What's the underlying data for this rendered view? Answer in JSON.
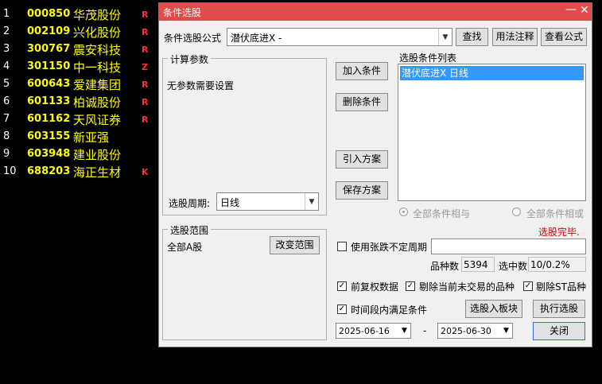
{
  "stocks": [
    {
      "idx": "1",
      "code": "000850",
      "name": "华茂股份",
      "flag": "R"
    },
    {
      "idx": "2",
      "code": "002109",
      "name": "兴化股份",
      "flag": "R"
    },
    {
      "idx": "3",
      "code": "300767",
      "name": "震安科技",
      "flag": "R"
    },
    {
      "idx": "4",
      "code": "301150",
      "name": "中一科技",
      "flag": "Z"
    },
    {
      "idx": "5",
      "code": "600643",
      "name": "爱建集团",
      "flag": "R"
    },
    {
      "idx": "6",
      "code": "601133",
      "name": "柏诚股份",
      "flag": "R"
    },
    {
      "idx": "7",
      "code": "601162",
      "name": "天风证券",
      "flag": "R"
    },
    {
      "idx": "8",
      "code": "603155",
      "name": "新亚强",
      "flag": ""
    },
    {
      "idx": "9",
      "code": "603948",
      "name": "建业股份",
      "flag": ""
    },
    {
      "idx": "10",
      "code": "688203",
      "name": "海正生材",
      "flag": "K"
    }
  ],
  "dialog": {
    "title": "条件选股",
    "formula_label": "条件选股公式",
    "formula_value": "潜伏底进X    -",
    "find_button": "查找",
    "usage_button": "用法注释",
    "view_formula_button": "查看公式",
    "calc_params_group": "计算参数",
    "no_params_text": "无参数需要设置",
    "period_label": "选股周期:",
    "period_value": "日线",
    "add_condition_button": "加入条件",
    "delete_condition_button": "删除条件",
    "import_plan_button": "引入方案",
    "save_plan_button": "保存方案",
    "condition_list_label": "选股条件列表",
    "condition_items": [
      "潜伏底进X  日线"
    ],
    "radio_and_label": "全部条件相与",
    "radio_or_label": "全部条件相或",
    "status_text": "选股完毕.",
    "range_group": "选股范围",
    "range_value": "全部A股",
    "change_range_button": "改变范围",
    "uncertain_period_label": "使用张跌不定周期",
    "count_label": "品种数",
    "count_value": "5394",
    "hit_label": "选中数",
    "hit_value": "10/0.2%",
    "adjusted_label": "前复权数据",
    "exclude_untraded_label": "剔除当前未交易的品种",
    "exclude_st_label": "剔除ST品种",
    "time_range_label": "时间段内满足条件",
    "to_block_button": "选股入板块",
    "execute_button": "执行选股",
    "close_button": "关闭",
    "date_start": "2025-06-16",
    "date_sep": "-",
    "date_end": "2025-06-30",
    "checkmark": "✓"
  }
}
